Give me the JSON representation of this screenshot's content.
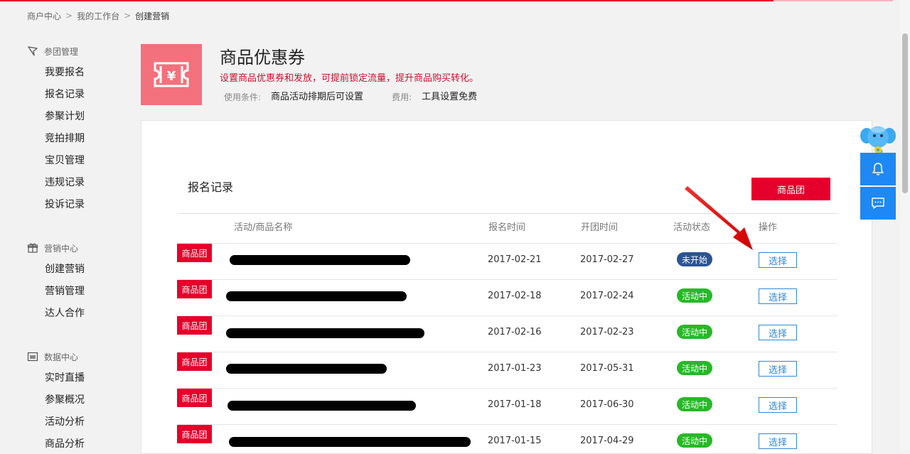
{
  "breadcrumb": {
    "items": [
      "商户中心",
      "我的工作台",
      "创建营销"
    ],
    "separator": ">"
  },
  "sidebar": {
    "groups": [
      {
        "title": "参团管理",
        "icon": "flag-icon",
        "items": [
          "我要报名",
          "报名记录",
          "参聚计划",
          "竞拍排期",
          "宝贝管理",
          "违规记录",
          "投诉记录"
        ]
      },
      {
        "title": "营销中心",
        "icon": "gift-icon",
        "items": [
          "创建营销",
          "营销管理",
          "达人合作"
        ]
      },
      {
        "title": "数据中心",
        "icon": "image-icon",
        "items": [
          "实时直播",
          "参聚概况",
          "活动分析",
          "商品分析"
        ]
      }
    ]
  },
  "hero": {
    "icon": "coupon-yen-icon",
    "title": "商品优惠券",
    "description": "设置商品优惠券和发放，可提前锁定流量，提升商品购买转化。",
    "condition_label": "使用条件:",
    "condition_value": "商品活动排期后可设置",
    "fee_label": "费用:",
    "fee_value": "工具设置免费"
  },
  "panel": {
    "title": "报名记录",
    "action_button": "商品团",
    "columns": [
      "活动/商品名称",
      "报名时间",
      "开团时间",
      "活动状态",
      "操作"
    ],
    "rows": [
      {
        "tag": "商品团",
        "signup": "2017-02-21",
        "start": "2017-02-27",
        "status": "未开始",
        "status_type": "pending",
        "action": "选择"
      },
      {
        "tag": "商品团",
        "signup": "2017-02-18",
        "start": "2017-02-24",
        "status": "活动中",
        "status_type": "active",
        "action": "选择"
      },
      {
        "tag": "商品团",
        "signup": "2017-02-16",
        "start": "2017-02-23",
        "status": "活动中",
        "status_type": "active",
        "action": "选择"
      },
      {
        "tag": "商品团",
        "signup": "2017-01-23",
        "start": "2017-05-31",
        "status": "活动中",
        "status_type": "active",
        "action": "选择"
      },
      {
        "tag": "商品团",
        "signup": "2017-01-18",
        "start": "2017-06-30",
        "status": "活动中",
        "status_type": "active",
        "action": "选择"
      },
      {
        "tag": "商品团",
        "signup": "2017-01-15",
        "start": "2017-04-29",
        "status": "活动中",
        "status_type": "active",
        "action": "选择"
      }
    ]
  },
  "float_tools": {
    "mascot": "elephant-mascot-icon",
    "buttons": [
      "bell-icon",
      "chat-icon"
    ]
  },
  "colors": {
    "brand_red": "#e5002b",
    "hero_pink": "#f2717d",
    "link_blue": "#2f88d7",
    "status_pending": "#2c5392",
    "status_active": "#26b926",
    "float_blue": "#1e88f4"
  }
}
